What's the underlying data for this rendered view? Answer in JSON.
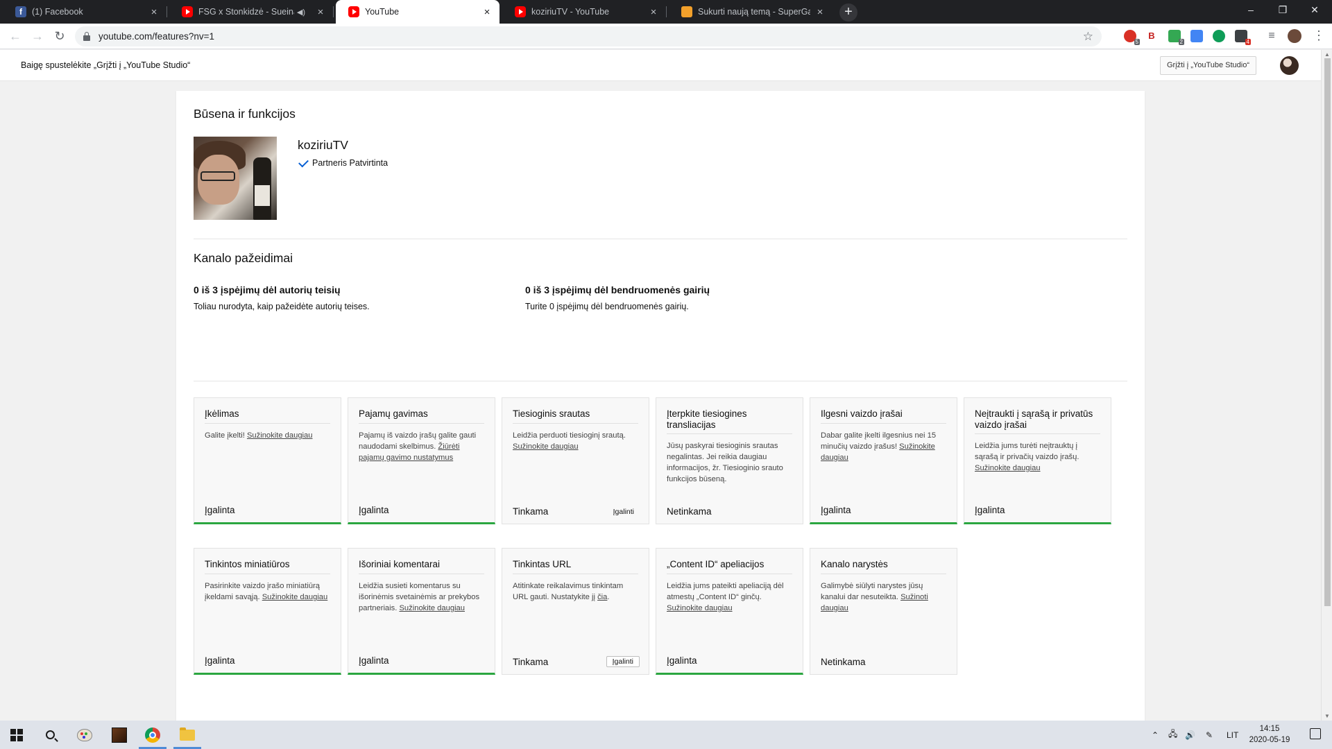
{
  "browser": {
    "tabs": [
      {
        "title": "(1) Facebook",
        "icon": "facebook-icon",
        "active": false
      },
      {
        "title": "FSG x Stonkidzė - Sueina (Pr",
        "icon": "youtube-icon",
        "active": false,
        "audio": true
      },
      {
        "title": "YouTube",
        "icon": "youtube-icon",
        "active": true
      },
      {
        "title": "koziriuTV - YouTube",
        "icon": "youtube-icon",
        "active": false
      },
      {
        "title": "Sukurti naują temą - SuperGame",
        "icon": "supergames-icon",
        "active": false
      }
    ],
    "url": "youtube.com/features?nv=1",
    "extension_badges": [
      "5",
      "2",
      "4"
    ]
  },
  "banner": {
    "message": "Baigę spustelėkite „Grįžti į „YouTube Studio“",
    "studio_button": "Grįžti į „YouTube Studio“"
  },
  "status": {
    "heading": "Būsena ir funkcijos",
    "channel_name": "koziriuTV",
    "partner_status": "Partneris Patvirtinta"
  },
  "violations": {
    "heading": "Kanalo pažeidimai",
    "copyright": {
      "title": "0 iš 3 įspėjimų dėl autorių teisių",
      "desc": "Toliau nurodyta, kaip pažeidėte autorių teises."
    },
    "community": {
      "title": "0 iš 3 įspėjimų dėl bendruomenės gairių",
      "desc": "Turite 0 įspėjimų dėl bendruomenės gairių."
    }
  },
  "features": [
    {
      "title": "Įkėlimas",
      "desc": "Galite įkelti!",
      "link": "Sužinokite daugiau",
      "status": "Įgalinta",
      "green": true,
      "enable_label": ""
    },
    {
      "title": "Pajamų gavimas",
      "desc": "Pajamų iš vaizdo įrašų galite gauti naudodami skelbimus.",
      "link": "Žiūrėti pajamų gavimo nustatymus",
      "status": "Įgalinta",
      "green": true,
      "enable_label": ""
    },
    {
      "title": "Tiesioginis srautas",
      "desc": "Leidžia perduoti tiesioginį srautą.",
      "link": "Sužinokite daugiau",
      "status": "Tinkama",
      "green": false,
      "enable_label": "Įgalinti"
    },
    {
      "title": "Įterpkite tiesiogines transliacijas",
      "desc": "Jūsų paskyrai tiesioginis srautas negalintas. Jei reikia daugiau informacijos, žr. Tiesioginio srauto funkcijos būseną.",
      "link": "",
      "status": "Netinkama",
      "green": false,
      "enable_label": ""
    },
    {
      "title": "Ilgesni vaizdo įrašai",
      "desc": "Dabar galite įkelti ilgesnius nei 15 minučių vaizdo įrašus!",
      "link": "Sužinokite daugiau",
      "status": "Įgalinta",
      "green": true,
      "enable_label": ""
    },
    {
      "title": "Neįtraukti į sąrašą ir privatūs vaizdo įrašai",
      "desc": "Leidžia jums turėti neįtrauktų į sąrašą ir privačių vaizdo įrašų.",
      "link": "Sužinokite daugiau",
      "status": "Įgalinta",
      "green": true,
      "enable_label": ""
    },
    {
      "title": "Tinkintos miniatiūros",
      "desc": "Pasirinkite vaizdo įrašo miniatiūrą įkeldami savąją.",
      "link": "Sužinokite daugiau",
      "status": "Įgalinta",
      "green": true,
      "enable_label": ""
    },
    {
      "title": "Išoriniai komentarai",
      "desc": "Leidžia susieti komentarus su išorinėmis svetainėmis ar prekybos partneriais.",
      "link": "Sužinokite daugiau",
      "status": "Įgalinta",
      "green": true,
      "enable_label": ""
    },
    {
      "title": "Tinkintas URL",
      "desc": "Atitinkate reikalavimus tinkintam URL gauti. Nustatykite jį",
      "link": "čia",
      "link_suffix": ".",
      "status": "Tinkama",
      "green": false,
      "enable_label": "Įgalinti"
    },
    {
      "title": "„Content ID“ apeliacijos",
      "desc": "Leidžia jums pateikti apeliaciją dėl atmestų „Content ID“ ginčų.",
      "link": "Sužinokite daugiau",
      "status": "Įgalinta",
      "green": true,
      "enable_label": ""
    },
    {
      "title": "Kanalo narystės",
      "desc": "Galimybė siūlyti narystes jūsų kanalui dar nesuteikta.",
      "link": "Sužinoti daugiau",
      "status": "Netinkama",
      "green": false,
      "enable_label": ""
    }
  ],
  "taskbar": {
    "language": "LIT",
    "time": "14:15",
    "date": "2020-05-19"
  },
  "colors": {
    "enabled_accent": "#2ba640",
    "link_check": "#065fd4",
    "tabstrip": "#202124"
  }
}
